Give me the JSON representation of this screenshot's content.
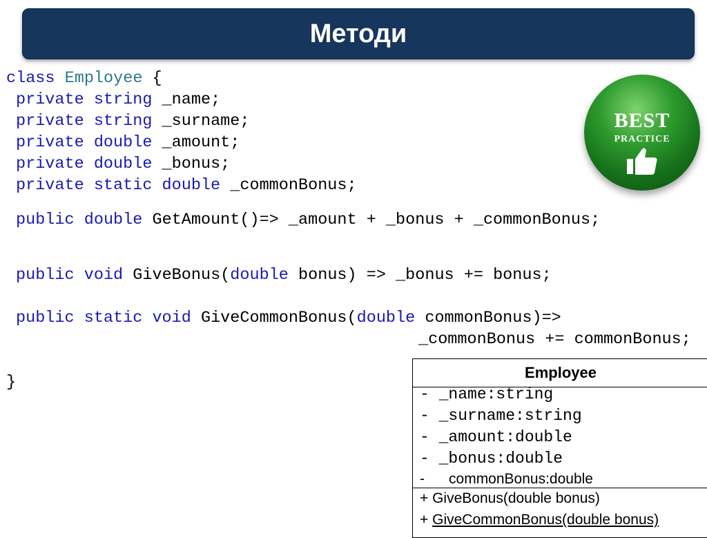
{
  "slide": {
    "title": "Методи"
  },
  "code": {
    "class_kw": "class",
    "class_name": "Employee",
    "open_brace": " {",
    "fields": [
      {
        "mod": "private",
        "type": "string",
        "name": " _name;"
      },
      {
        "mod": "private",
        "type": "string",
        "name": " _surname;"
      },
      {
        "mod": "private",
        "type": "double",
        "name": " _amount;"
      },
      {
        "mod": "private",
        "type": "double",
        "name": " _bonus;"
      },
      {
        "mod": "private static",
        "type": "double",
        "name": " _commonBonus;"
      }
    ],
    "get_amount": {
      "mod": "public",
      "type": "double",
      "rest": " GetAmount()=> _amount + _bonus + _commonBonus;"
    },
    "give_bonus": {
      "mod": "public",
      "type": "void",
      "name": " GiveBonus(",
      "param_type": "double",
      "rest": " bonus) => _bonus += bonus;"
    },
    "give_common_bonus": {
      "mod": "public static",
      "type": "void",
      "name": " GiveCommonBonus(",
      "param_type": "double",
      "rest": " commonBonus)=>",
      "line2": "_commonBonus += commonBonus;"
    },
    "close_brace": "}"
  },
  "badge": {
    "line1": "BEST",
    "line2": "PRACTICE",
    "icon": "thumbs-up-icon",
    "color": "#1f8a24"
  },
  "uml": {
    "class_name": "Employee",
    "attributes": [
      "- _name:string",
      "- _surname:string",
      "- _amount:double",
      "- _bonus:double"
    ],
    "last_attribute_dash": "-",
    "last_attribute": "commonBonus:double",
    "methods": [
      "+ GiveBonus(double bonus)"
    ],
    "method_underlined_prefix": "+ ",
    "method_underlined": "GiveCommonBonus(double bonus)"
  },
  "colors": {
    "title_bar": "#17365d",
    "keyword": "#1a1ab0",
    "type_name": "#2b7a8a"
  }
}
